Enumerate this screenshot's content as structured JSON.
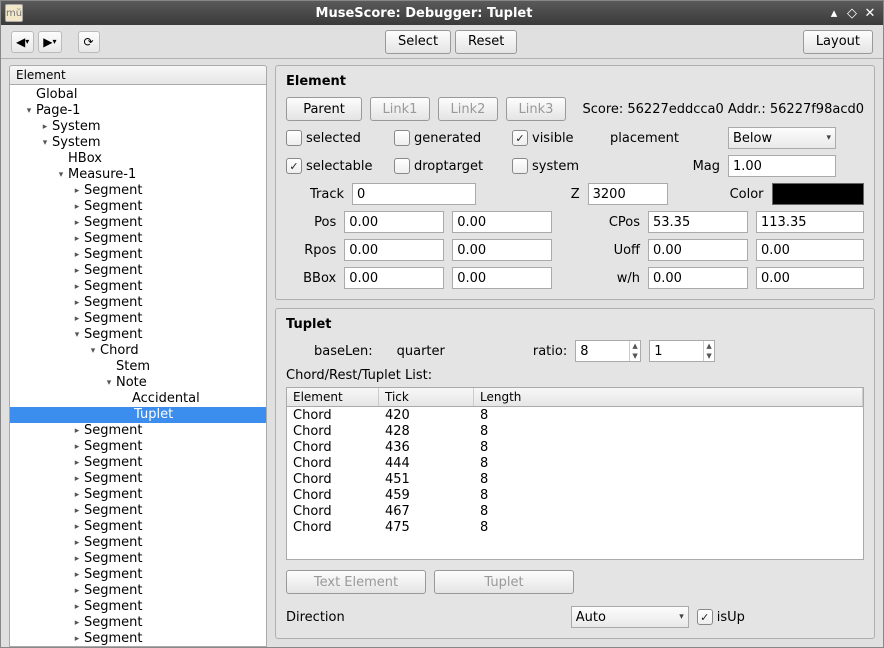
{
  "window": {
    "title": "MuseScore: Debugger: Tuplet"
  },
  "toolbar": {
    "select_label": "Select",
    "reset_label": "Reset",
    "layout_label": "Layout"
  },
  "tree": {
    "header": "Element",
    "nodes": [
      {
        "d": 0,
        "tw": "",
        "label": "Global"
      },
      {
        "d": 0,
        "tw": "v",
        "label": "Page-1"
      },
      {
        "d": 1,
        "tw": ">",
        "label": "System"
      },
      {
        "d": 1,
        "tw": "v",
        "label": "System"
      },
      {
        "d": 2,
        "tw": "",
        "label": "HBox"
      },
      {
        "d": 2,
        "tw": "v",
        "label": "Measure-1"
      },
      {
        "d": 3,
        "tw": ">",
        "label": "Segment"
      },
      {
        "d": 3,
        "tw": ">",
        "label": "Segment"
      },
      {
        "d": 3,
        "tw": ">",
        "label": "Segment"
      },
      {
        "d": 3,
        "tw": ">",
        "label": "Segment"
      },
      {
        "d": 3,
        "tw": ">",
        "label": "Segment"
      },
      {
        "d": 3,
        "tw": ">",
        "label": "Segment"
      },
      {
        "d": 3,
        "tw": ">",
        "label": "Segment"
      },
      {
        "d": 3,
        "tw": ">",
        "label": "Segment"
      },
      {
        "d": 3,
        "tw": ">",
        "label": "Segment"
      },
      {
        "d": 3,
        "tw": "v",
        "label": "Segment"
      },
      {
        "d": 4,
        "tw": "v",
        "label": "Chord"
      },
      {
        "d": 5,
        "tw": "",
        "label": "Stem"
      },
      {
        "d": 5,
        "tw": "v",
        "label": "Note"
      },
      {
        "d": 6,
        "tw": "",
        "label": "Accidental"
      },
      {
        "d": 6,
        "tw": "",
        "label": "Tuplet",
        "sel": true
      },
      {
        "d": 3,
        "tw": ">",
        "label": "Segment"
      },
      {
        "d": 3,
        "tw": ">",
        "label": "Segment"
      },
      {
        "d": 3,
        "tw": ">",
        "label": "Segment"
      },
      {
        "d": 3,
        "tw": ">",
        "label": "Segment"
      },
      {
        "d": 3,
        "tw": ">",
        "label": "Segment"
      },
      {
        "d": 3,
        "tw": ">",
        "label": "Segment"
      },
      {
        "d": 3,
        "tw": ">",
        "label": "Segment"
      },
      {
        "d": 3,
        "tw": ">",
        "label": "Segment"
      },
      {
        "d": 3,
        "tw": ">",
        "label": "Segment"
      },
      {
        "d": 3,
        "tw": ">",
        "label": "Segment"
      },
      {
        "d": 3,
        "tw": ">",
        "label": "Segment"
      },
      {
        "d": 3,
        "tw": ">",
        "label": "Segment"
      },
      {
        "d": 3,
        "tw": ">",
        "label": "Segment"
      },
      {
        "d": 3,
        "tw": ">",
        "label": "Segment"
      }
    ]
  },
  "element_group": {
    "title": "Element",
    "parent": "Parent",
    "link1": "Link1",
    "link2": "Link2",
    "link3": "Link3",
    "score_label": "Score: 56227eddcca0 Addr.: 56227f98acd0",
    "selected": {
      "label": "selected",
      "checked": false
    },
    "generated": {
      "label": "generated",
      "checked": false
    },
    "visible": {
      "label": "visible",
      "checked": true
    },
    "placement_label": "placement",
    "placement_value": "Below",
    "selectable": {
      "label": "selectable",
      "checked": true
    },
    "droptarget": {
      "label": "droptarget",
      "checked": false
    },
    "system": {
      "label": "system",
      "checked": false
    },
    "mag_label": "Mag",
    "mag_value": "1.00",
    "track_label": "Track",
    "track_value": "0",
    "z_label": "Z",
    "z_value": "3200",
    "color_label": "Color",
    "color_value": "#000000",
    "pos_label": "Pos",
    "pos_x": "0.00",
    "pos_y": "0.00",
    "cpos_label": "CPos",
    "cpos_x": "53.35",
    "cpos_y": "113.35",
    "rpos_label": "Rpos",
    "rpos_x": "0.00",
    "rpos_y": "0.00",
    "uoff_label": "Uoff",
    "uoff_x": "0.00",
    "uoff_y": "0.00",
    "bbox_label": "BBox",
    "bbox_x": "0.00",
    "bbox_y": "0.00",
    "wh_label": "w/h",
    "wh_x": "0.00",
    "wh_y": "0.00"
  },
  "tuplet_group": {
    "title": "Tuplet",
    "baselen_label": "baseLen:",
    "baselen_value": "quarter",
    "ratio_label": "ratio:",
    "ratio_a": "8",
    "ratio_b": "1",
    "list_label": "Chord/Rest/Tuplet List:",
    "columns": {
      "element": "Element",
      "tick": "Tick",
      "length": "Length"
    },
    "rows": [
      {
        "element": "Chord",
        "tick": "420",
        "length": "8"
      },
      {
        "element": "Chord",
        "tick": "428",
        "length": "8"
      },
      {
        "element": "Chord",
        "tick": "436",
        "length": "8"
      },
      {
        "element": "Chord",
        "tick": "444",
        "length": "8"
      },
      {
        "element": "Chord",
        "tick": "451",
        "length": "8"
      },
      {
        "element": "Chord",
        "tick": "459",
        "length": "8"
      },
      {
        "element": "Chord",
        "tick": "467",
        "length": "8"
      },
      {
        "element": "Chord",
        "tick": "475",
        "length": "8"
      }
    ],
    "text_element_btn": "Text Element",
    "tuplet_btn": "Tuplet",
    "direction_label": "Direction",
    "direction_value": "Auto",
    "isup": {
      "label": "isUp",
      "checked": true
    }
  }
}
